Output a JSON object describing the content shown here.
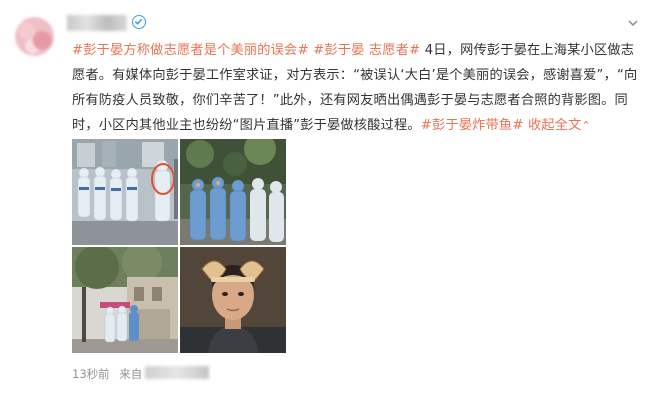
{
  "post": {
    "author_name": "",
    "avatar": "blurred-avatar",
    "text_segments": [
      {
        "kind": "tag",
        "text": "#彭于晏方称做志愿者是个美丽的误会#"
      },
      {
        "kind": "tag",
        "text": " #彭于晏 志愿者#"
      },
      {
        "kind": "text",
        "text": " 4日，网传彭于晏在上海某小区做志愿者。有媒体向彭于晏工作室求证，对方表示：“被误认‘大白’是个美丽的误会，感谢喜爱”，“向所有防疫人员致敬，你们辛苦了！”此外，还有网友晒出偶遇彭于晏与志愿者合照的背影图。同时，小区内其他业主也纷纷“图片直播”彭于晏做核酸过程。"
      },
      {
        "kind": "tag",
        "text": "#彭于晏炸带鱼#"
      },
      {
        "kind": "more",
        "text": " 收起全文"
      }
    ],
    "more_icon": "chevron-up-icon",
    "images": [
      {
        "name": "photo-volunteers-group-1",
        "desc": "volunteers-in-protective-suits"
      },
      {
        "name": "photo-volunteers-group-2",
        "desc": "volunteers-in-blue-suits"
      },
      {
        "name": "photo-building-entrance",
        "desc": "residential-building-with-volunteers"
      },
      {
        "name": "photo-portrait",
        "desc": "man-with-headband"
      }
    ],
    "time": "13秒前",
    "source_label": "来自",
    "source_value": ""
  },
  "colors": {
    "link": "#eb7350",
    "text": "#333333",
    "meta": "#939393",
    "verified": "#3b9cf2"
  }
}
